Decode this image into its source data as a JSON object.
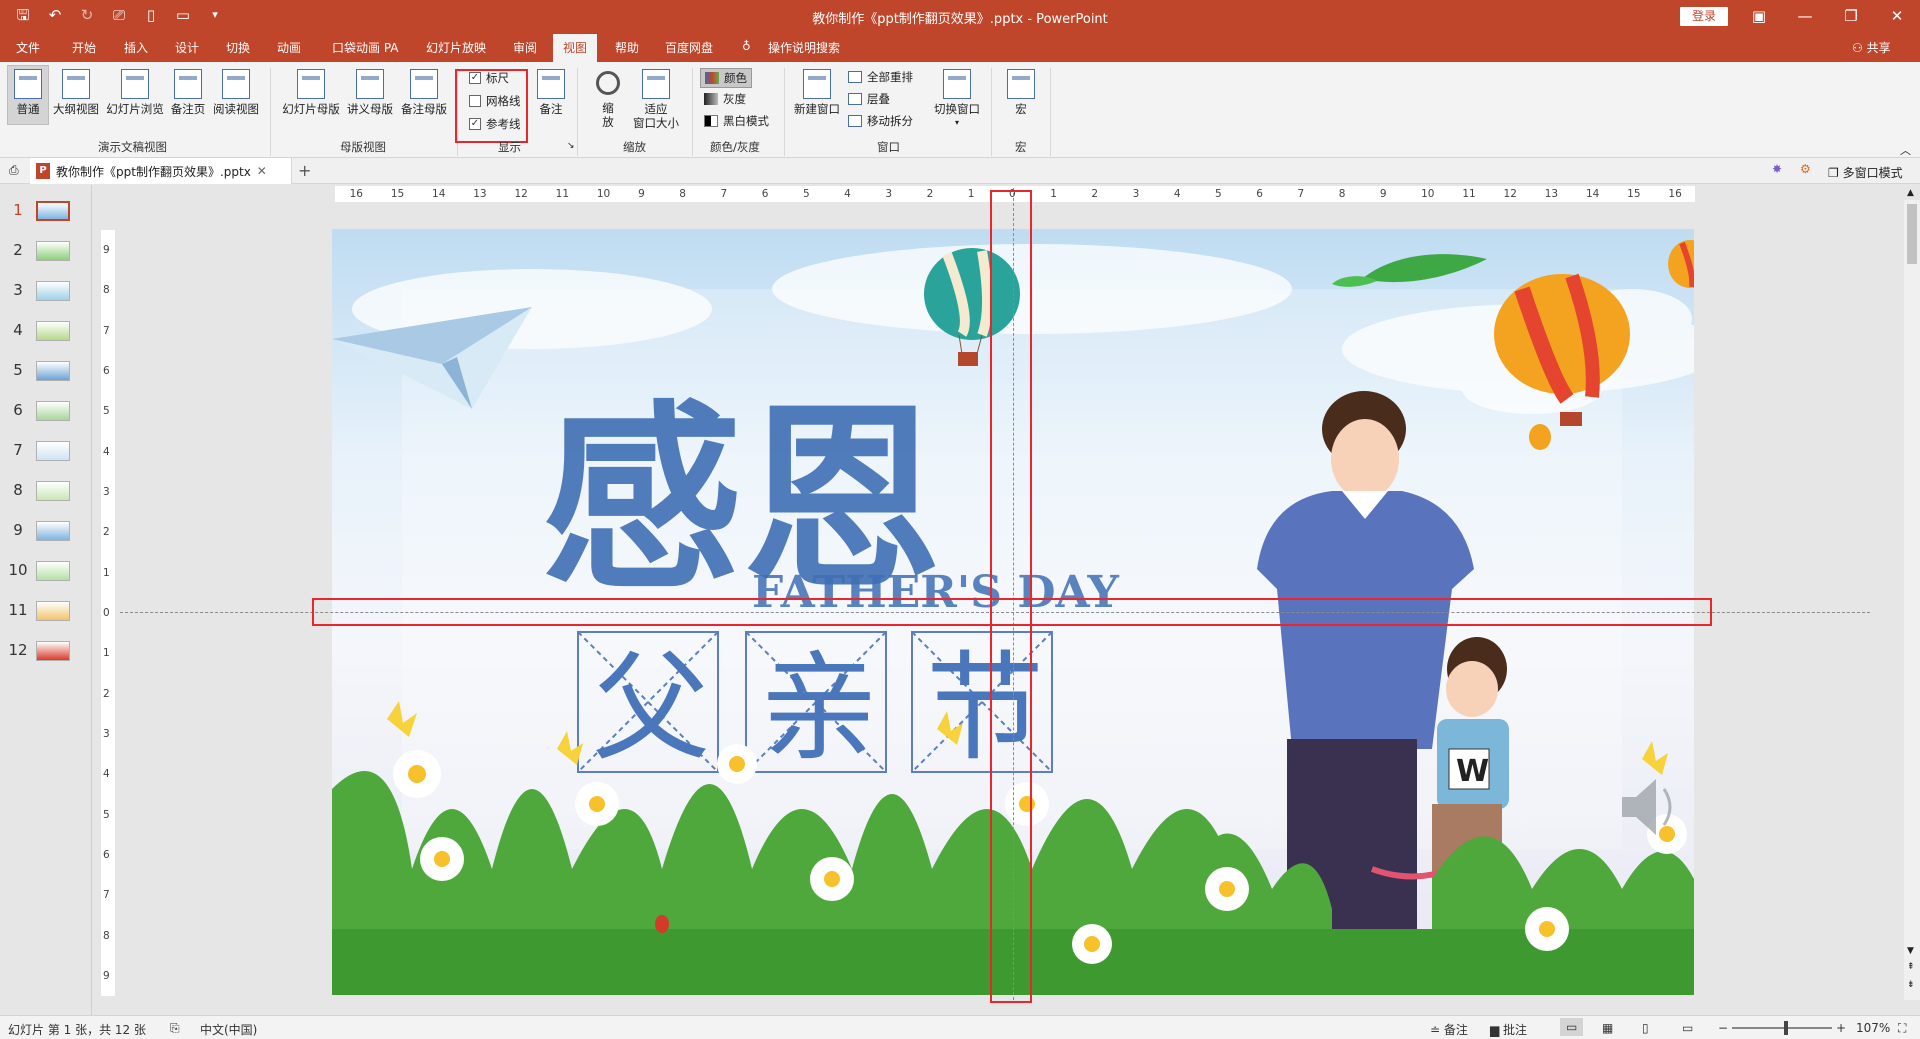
{
  "window": {
    "title": "教你制作《ppt制作翻页效果》.pptx - PowerPoint",
    "login_label": "登录",
    "controls": [
      "ribbon-display-icon",
      "minimize-icon",
      "restore-icon",
      "close-icon"
    ]
  },
  "menu": {
    "tabs": [
      "文件",
      "开始",
      "插入",
      "设计",
      "切换",
      "动画",
      "口袋动画 PA",
      "幻灯片放映",
      "审阅",
      "视图",
      "帮助",
      "百度网盘"
    ],
    "active_tab": "视图",
    "tell_me": "操作说明搜索",
    "share": "共享"
  },
  "ribbon": {
    "presentation_views": {
      "label": "演示文稿视图",
      "buttons": [
        "普通",
        "大纲视图",
        "幻灯片浏览",
        "备注页",
        "阅读视图"
      ],
      "selected": "普通"
    },
    "master_views": {
      "label": "母版视图",
      "buttons": [
        "幻灯片母版",
        "讲义母版",
        "备注母版"
      ]
    },
    "show": {
      "label": "显示",
      "checkboxes": [
        {
          "label": "标尺",
          "checked": true
        },
        {
          "label": "网格线",
          "checked": false
        },
        {
          "label": "参考线",
          "checked": true
        }
      ],
      "notes_button": "备注"
    },
    "zoom": {
      "label": "缩放",
      "zoom_button": "缩\n放",
      "fit_button": "适应\n窗口大小"
    },
    "color": {
      "label": "颜色/灰度",
      "options": [
        "颜色",
        "灰度",
        "黑白模式"
      ],
      "selected": "颜色"
    },
    "window": {
      "label": "窗口",
      "new_window": "新建窗口",
      "items": [
        "全部重排",
        "层叠",
        "移动拆分"
      ],
      "switch": "切换窗口"
    },
    "macros": {
      "label": "宏",
      "button": "宏"
    }
  },
  "document_tab": {
    "name": "教你制作《ppt制作翻页效果》.pptx",
    "multi_window": "多窗口模式"
  },
  "slides": {
    "count": 12,
    "current": 1,
    "numbers": [
      "1",
      "2",
      "3",
      "4",
      "5",
      "6",
      "7",
      "8",
      "9",
      "10",
      "11",
      "12"
    ]
  },
  "rulers": {
    "horizontal_labels": [
      "16",
      "15",
      "14",
      "13",
      "12",
      "11",
      "10",
      "9",
      "8",
      "7",
      "6",
      "5",
      "4",
      "3",
      "2",
      "1",
      "0",
      "1",
      "2",
      "3",
      "4",
      "5",
      "6",
      "7",
      "8",
      "9",
      "10",
      "11",
      "12",
      "13",
      "14",
      "15",
      "16"
    ],
    "vertical_labels": [
      "9",
      "8",
      "7",
      "6",
      "5",
      "4",
      "3",
      "2",
      "1",
      "0",
      "1",
      "2",
      "3",
      "4",
      "5",
      "6",
      "7",
      "8",
      "9"
    ]
  },
  "slide_content": {
    "title_cn": "感恩",
    "subtitle_en": "FATHER'S DAY",
    "chars": [
      "父",
      "亲",
      "节"
    ],
    "shirt_letter": "W"
  },
  "status": {
    "slide_info": "幻灯片 第 1 张，共 12 张",
    "language": "中文(中国)",
    "notes": "备注",
    "comments": "批注",
    "zoom_level": "107%"
  },
  "colors": {
    "accent": "#c0462b",
    "highlight_box": "#e8262b",
    "title_blue": "#3f6fb5"
  }
}
